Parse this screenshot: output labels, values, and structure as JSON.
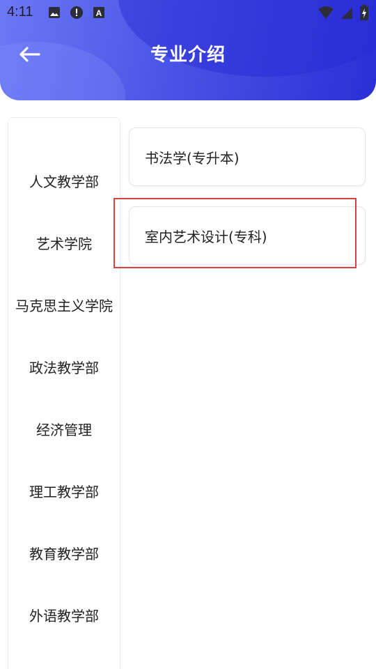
{
  "status_bar": {
    "time": "4:11",
    "left_icons": [
      "image-icon",
      "alert-icon",
      "a-box-icon"
    ],
    "right_icons": [
      "wifi-icon",
      "signal-icon",
      "battery-icon"
    ]
  },
  "header": {
    "title": "专业介绍",
    "back_icon": "back-arrow-icon"
  },
  "departments": [
    "人文教学部",
    "艺术学院",
    "马克思主义学院",
    "政法教学部",
    "经济管理",
    "理工教学部",
    "教育教学部",
    "外语教学部"
  ],
  "majors": [
    "书法学(专升本)",
    "室内艺术设计(专科)"
  ],
  "colors": {
    "header_start": "#6c78f5",
    "header_end": "#2a2fd6",
    "highlight": "#d9413f"
  }
}
